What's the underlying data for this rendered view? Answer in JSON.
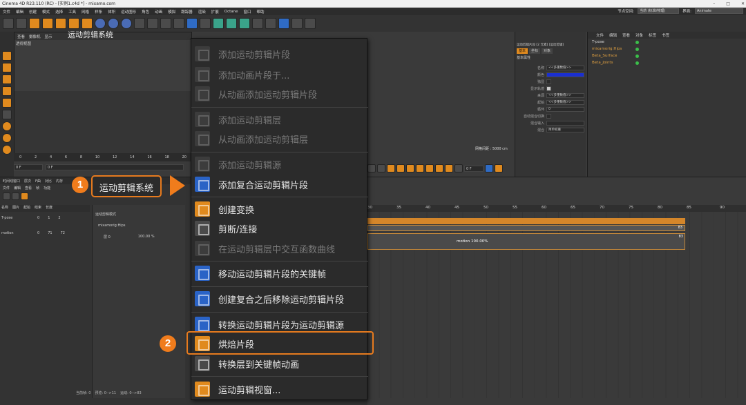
{
  "window": {
    "title": "Cinema 4D R23.110 (RC) - [实例1.c4d *] - mixamo.com",
    "controls": [
      "–",
      "□",
      "✕"
    ]
  },
  "menubar": {
    "items": [
      "文件",
      "编辑",
      "创建",
      "模式",
      "选择",
      "工具",
      "网格",
      "样条",
      "体积",
      "运动图形",
      "角色",
      "动画",
      "模拟",
      "跟踪器",
      "渲染",
      "扩展",
      "Octane",
      "窗口",
      "帮助"
    ],
    "node_space_label": "节点空间:",
    "node_space_value": "当前 (标准/物理)",
    "layout_label": "界面:",
    "layout_value": "Animate"
  },
  "viewport": {
    "tabs": [
      "查看",
      "摄像机",
      "显示"
    ],
    "title": "透视视图",
    "grid_spacing": "网格间距 : 5000 cm"
  },
  "timeline_ruler": {
    "ticks": [
      "0",
      "2",
      "4",
      "6",
      "8",
      "10",
      "12",
      "14",
      "16",
      "18",
      "20"
    ]
  },
  "frame_inputs": {
    "start": "0 F",
    "current": "0 F",
    "end": "0 F"
  },
  "attributes": {
    "header": "运动剪辑片段 [2 元素] [运动剪辑]",
    "tabs": [
      "基本",
      "坐标",
      "对象"
    ],
    "section": "基本属性",
    "name_label": "名称",
    "name_value": "<<多重数值>>",
    "color_label": "颜色",
    "solo_label": "独显",
    "show_track_label": "显示轨迹",
    "source_label": "来源",
    "source_value": "<<多重数值>>",
    "start_label": "起始",
    "start_value": "<<多重数值>>",
    "loop_label": "循环",
    "loop_value": "0",
    "auto_label": "自动混合切换",
    "blend_label": "混合输入",
    "mix_label": "混合",
    "mix_value": "简单权重"
  },
  "objects": {
    "menu": [
      "文件",
      "编辑",
      "查看",
      "对象",
      "标签",
      "书签"
    ],
    "rows": [
      {
        "name": "T-pose"
      },
      {
        "name": "mixamorig:Hips"
      },
      {
        "name": "Beta_Surface"
      },
      {
        "name": "Beta_Joints"
      }
    ]
  },
  "motion_system": {
    "tabs": [
      "时间线窗口",
      "层次",
      "F曲",
      "对比",
      "内存"
    ],
    "menu": [
      "文件",
      "编辑",
      "查看",
      "帧",
      "功能"
    ],
    "columns": [
      "名称",
      "图片",
      "起始",
      "结束",
      "长度"
    ],
    "rows": [
      {
        "name": "T-pose",
        "start": "0",
        "end": "1",
        "length": "2"
      },
      {
        "name": "motion",
        "start": "0",
        "end": "71",
        "length": "72"
      }
    ],
    "sub_header": "运动剪辑模式",
    "sub_rows": [
      "mixamorig:Hips",
      "层 0",
      "100.00 %"
    ],
    "status": [
      "当前帧: 0",
      "预览: 0-->11",
      "运动: 0-->83"
    ]
  },
  "timeline": {
    "ticks": [
      "30",
      "35",
      "40",
      "45",
      "50",
      "55",
      "60",
      "65",
      "70",
      "75",
      "80",
      "85",
      "90"
    ],
    "top_clip_end": "83",
    "clip_label": "motion 100.00%",
    "clip_end": "83"
  },
  "callout": {
    "step1": "1",
    "step1_label": "运动剪辑系统",
    "step2": "2"
  },
  "tab_label": "运动剪辑系统",
  "context_menu": {
    "items": [
      {
        "label": "添加运动剪辑片段",
        "enabled": false
      },
      {
        "label": "添加动画片段于...",
        "enabled": false
      },
      {
        "label": "从动画添加运动剪辑片段",
        "enabled": false
      },
      {
        "label": "添加运动剪辑层",
        "enabled": false
      },
      {
        "label": "从动画添加运动剪辑层",
        "enabled": false
      },
      {
        "label": "添加运动剪辑源",
        "enabled": false
      },
      {
        "label": "添加复合运动剪辑片段",
        "enabled": true
      },
      {
        "label": "创建变换",
        "enabled": true
      },
      {
        "label": "剪断/连接",
        "enabled": true
      },
      {
        "label": "在运动剪辑层中交互函数曲线",
        "enabled": false
      },
      {
        "label": "移动运动剪辑片段的关键帧",
        "enabled": true
      },
      {
        "label": "创建复合之后移除运动剪辑片段",
        "enabled": true
      },
      {
        "label": "转换运动剪辑片段为运动剪辑源",
        "enabled": true
      },
      {
        "label": "烘焙片段",
        "enabled": true
      },
      {
        "label": "转换层到关键帧动画",
        "enabled": true
      },
      {
        "label": "运动剪辑视窗...",
        "enabled": true
      }
    ]
  }
}
